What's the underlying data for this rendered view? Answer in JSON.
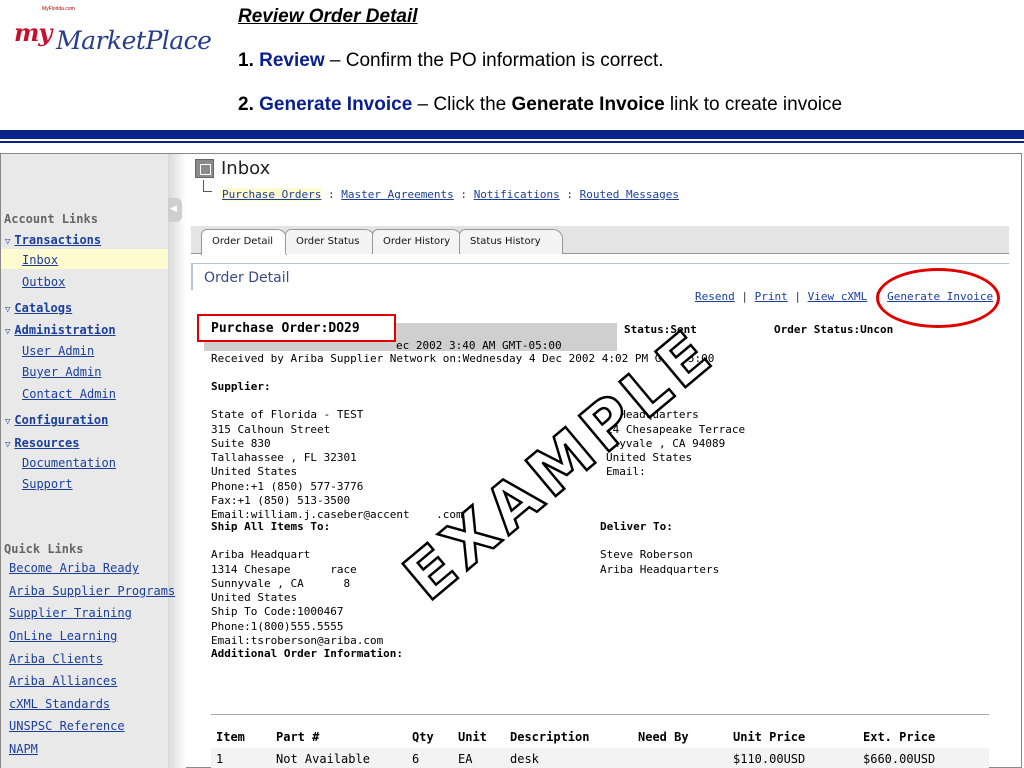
{
  "logo": {
    "sub": "MyFlorida.com",
    "my": "my",
    "mp": "MarketPlace"
  },
  "header": {
    "title": "Review Order Detail",
    "step1": {
      "num": "1.",
      "kw": "Review",
      "text": " – Confirm the PO  information is correct."
    },
    "step2": {
      "num": "2.",
      "kw": "Generate Invoice",
      "text1": " – Click the ",
      "bold": "Generate Invoice",
      "text2": " link to create invoice"
    }
  },
  "sidebar": {
    "account_heading": "Account Links",
    "transactions": "Transactions",
    "inbox": "Inbox",
    "outbox": "Outbox",
    "catalogs": "Catalogs",
    "administration": "Administration",
    "user_admin": "User Admin",
    "buyer_admin": "Buyer Admin",
    "contact_admin": "Contact Admin",
    "configuration": "Configuration",
    "resources": "Resources",
    "documentation": "Documentation",
    "support": "Support",
    "quick_heading": "Quick Links",
    "quick_links": [
      "Become Ariba Ready",
      "Ariba Supplier Programs",
      "Supplier Training",
      "OnLine Learning",
      "Ariba Clients",
      "Ariba Alliances",
      "cXML Standards",
      "UNSPSC Reference",
      "NAPM"
    ]
  },
  "inbox": {
    "title": "Inbox",
    "crumbs": {
      "purchase_orders": "Purchase Orders",
      "master": "Master Agreements",
      "notifications": "Notifications",
      "routed": "Routed Messages",
      "sep": " : "
    }
  },
  "tabs": [
    "Order Detail",
    "Order Status",
    "Order History",
    "Status History"
  ],
  "order": {
    "section_title": "Order Detail",
    "actions": {
      "resend": "Resend",
      "print": "Print",
      "view_cxml": "View cXML",
      "generate": "Generate Invoice",
      "sep": " | "
    },
    "po_label": "Purchase Order:DO29",
    "status_label": "Status:",
    "status_value": "Sent",
    "order_status_label": "Order Status:",
    "order_status_value": "Uncon",
    "date_line": "ec 2002 3:40 AM GMT-05:00",
    "received_line": "Received by Ariba Supplier Network on:Wednesday 4 Dec 2002 4:02 PM G   05:00",
    "supplier_label": "Supplier:",
    "supplier_lines": [
      "State of Florida - TEST",
      "315 Calhoun Street",
      "Suite 830",
      "Tallahassee , FL 32301",
      "United States",
      "Phone:+1 (850) 577-3776",
      "Fax:+1 (850) 513-3500",
      "Email:william.j.caseber@accent    .com"
    ],
    "customer_label": ":",
    "customer_lines": [
      "  Headquarters",
      "14 Chesapeake Terrace",
      "nnyvale , CA 94089",
      "United States",
      "Email:"
    ],
    "ship_label": "Ship All Items To:",
    "ship_lines": [
      "Ariba Headquart",
      "1314 Chesape      race",
      "Sunnyvale , CA      8",
      "United States",
      "Ship To Code:1000467",
      "Phone:1(800)555.5555",
      "Email:tsroberson@ariba.com"
    ],
    "deliver_label": "Deliver To:",
    "deliver_lines": [
      "Steve Roberson",
      "Ariba Headquarters"
    ],
    "additional_label": "Additional Order Information:"
  },
  "items": {
    "headers": [
      "Item",
      "Part #",
      "Qty",
      "Unit",
      "Description",
      "Need By",
      "Unit Price",
      "Ext. Price"
    ],
    "rows": [
      [
        "1",
        "Not Available",
        "6",
        "EA",
        "desk",
        "",
        "$110.00USD",
        "$660.00USD"
      ]
    ]
  },
  "watermark": "EXAMPLE"
}
